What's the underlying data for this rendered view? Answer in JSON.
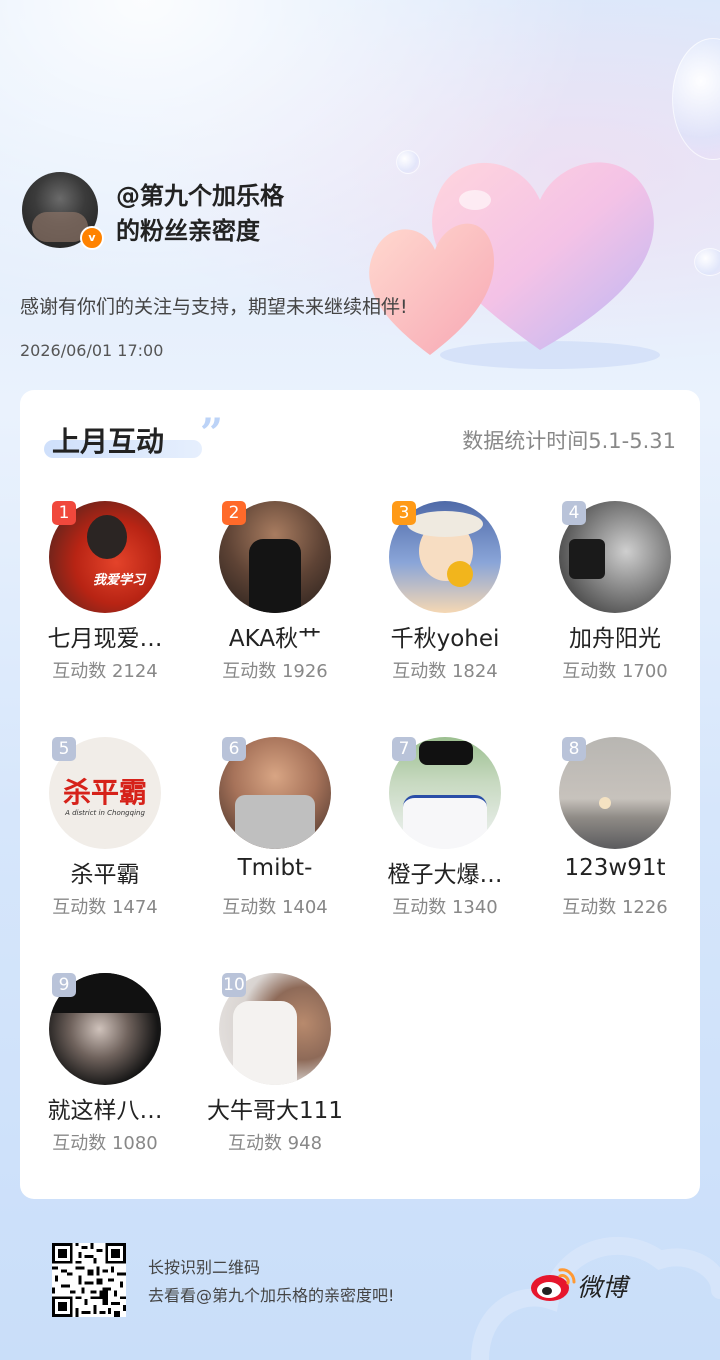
{
  "header": {
    "account_line1": "@第九个加乐格",
    "account_line2": "的粉丝亲密度",
    "verified_badge": "v",
    "thanks_text": "感谢有你们的关注与支持，期望未来继续相伴!",
    "datetime": "2026/06/01  17:00"
  },
  "card": {
    "title": "上月互动",
    "stat_period": "数据统计时间5.1-5.31"
  },
  "fans": [
    {
      "rank": "1",
      "name": "七月现爱…",
      "count": "互动数 2124",
      "rank_color": "#f0483c"
    },
    {
      "rank": "2",
      "name": "AKA秋艹",
      "count": "互动数 1926",
      "rank_color": "#ff6a2a"
    },
    {
      "rank": "3",
      "name": "千秋yohei",
      "count": "互动数 1824",
      "rank_color": "#ff9a17"
    },
    {
      "rank": "4",
      "name": "加舟阳光",
      "count": "互动数 1700",
      "rank_color": "#b9c3d9"
    },
    {
      "rank": "5",
      "name": "杀平霸",
      "count": "互动数 1474",
      "rank_color": "#b9c3d9"
    },
    {
      "rank": "6",
      "name": "Tmibt-",
      "count": "互动数 1404",
      "rank_color": "#b9c3d9"
    },
    {
      "rank": "7",
      "name": "橙子大爆…",
      "count": "互动数 1340",
      "rank_color": "#b9c3d9"
    },
    {
      "rank": "8",
      "name": "123w91t",
      "count": "互动数 1226",
      "rank_color": "#b9c3d9"
    },
    {
      "rank": "9",
      "name": "就这样八…",
      "count": "互动数 1080",
      "rank_color": "#b9c3d9"
    },
    {
      "rank": "10",
      "name": "大牛哥大111",
      "count": "互动数 948",
      "rank_color": "#b9c3d9"
    }
  ],
  "avatar_texts": {
    "fan1_caption": "我爱学习",
    "fan5_logo": "杀平霸",
    "fan5_sub": "A district in Chongqing"
  },
  "footer": {
    "qr_hint_line1": "长按识别二维码",
    "qr_hint_line2": "去看看@第九个加乐格的亲密度吧!",
    "brand": "微博"
  }
}
